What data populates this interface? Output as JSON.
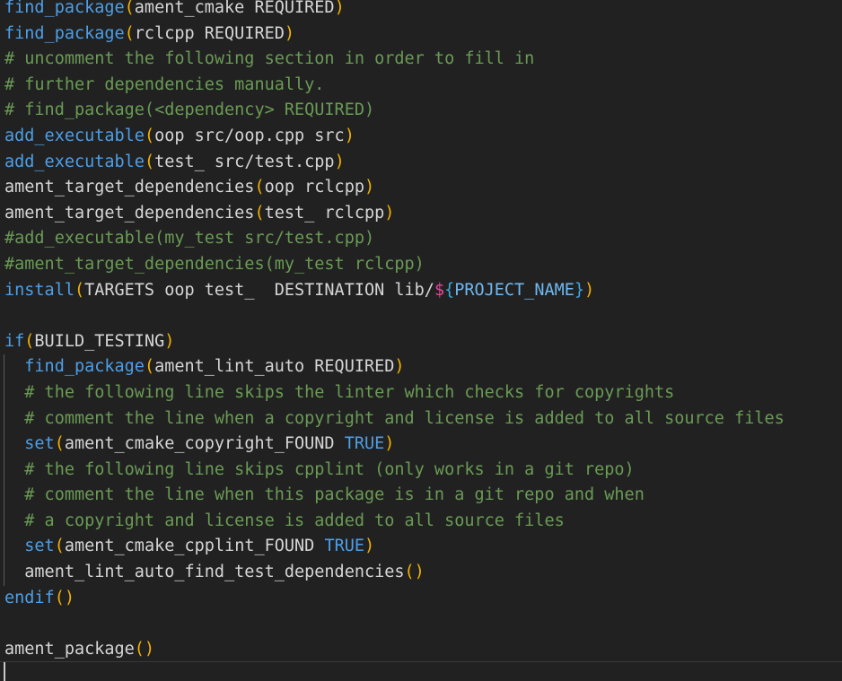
{
  "editor": {
    "language": "cmake",
    "background_color": "#212121",
    "colors": {
      "command": "#4d9fe8",
      "identifier": "#d6d6d6",
      "paren": "#f2b202",
      "comment": "#6a9b55",
      "keyword": "#4d9fe8",
      "variable_dollar": "#e8489b",
      "variable_brace": "#3aa9e0",
      "variable_name": "#6fb8f0",
      "indent_guide": "#5a5a5a",
      "caret": "#c8c8c8"
    },
    "caret_visible": true
  },
  "code": {
    "lines": [
      {
        "n": 1,
        "indent_guide": false,
        "tokens": [
          {
            "t": "find_package",
            "c": "cmd"
          },
          {
            "t": "(",
            "c": "paren"
          },
          {
            "t": "ament_cmake REQUIRED",
            "c": "id"
          },
          {
            "t": ")",
            "c": "paren"
          }
        ]
      },
      {
        "n": 2,
        "indent_guide": false,
        "tokens": [
          {
            "t": "find_package",
            "c": "cmd"
          },
          {
            "t": "(",
            "c": "paren"
          },
          {
            "t": "rclcpp REQUIRED",
            "c": "id"
          },
          {
            "t": ")",
            "c": "paren"
          }
        ]
      },
      {
        "n": 3,
        "indent_guide": false,
        "tokens": [
          {
            "t": "# uncomment the following section in order to fill in",
            "c": "comment"
          }
        ]
      },
      {
        "n": 4,
        "indent_guide": false,
        "tokens": [
          {
            "t": "# further dependencies manually.",
            "c": "comment"
          }
        ]
      },
      {
        "n": 5,
        "indent_guide": false,
        "tokens": [
          {
            "t": "# find_package(<dependency> REQUIRED)",
            "c": "comment"
          }
        ]
      },
      {
        "n": 6,
        "indent_guide": false,
        "tokens": [
          {
            "t": "add_executable",
            "c": "cmd"
          },
          {
            "t": "(",
            "c": "paren"
          },
          {
            "t": "oop src/oop.cpp src",
            "c": "id"
          },
          {
            "t": ")",
            "c": "paren"
          }
        ]
      },
      {
        "n": 7,
        "indent_guide": false,
        "tokens": [
          {
            "t": "add_executable",
            "c": "cmd"
          },
          {
            "t": "(",
            "c": "paren"
          },
          {
            "t": "test_ src/test.cpp",
            "c": "id"
          },
          {
            "t": ")",
            "c": "paren"
          }
        ]
      },
      {
        "n": 8,
        "indent_guide": false,
        "tokens": [
          {
            "t": "ament_target_dependencies",
            "c": "id"
          },
          {
            "t": "(",
            "c": "paren"
          },
          {
            "t": "oop rclcpp",
            "c": "id"
          },
          {
            "t": ")",
            "c": "paren"
          }
        ]
      },
      {
        "n": 9,
        "indent_guide": false,
        "tokens": [
          {
            "t": "ament_target_dependencies",
            "c": "id"
          },
          {
            "t": "(",
            "c": "paren"
          },
          {
            "t": "test_ rclcpp",
            "c": "id"
          },
          {
            "t": ")",
            "c": "paren"
          }
        ]
      },
      {
        "n": 10,
        "indent_guide": false,
        "tokens": [
          {
            "t": "#add_executable(my_test src/test.cpp)",
            "c": "comment"
          }
        ]
      },
      {
        "n": 11,
        "indent_guide": false,
        "tokens": [
          {
            "t": "#ament_target_dependencies(my_test rclcpp)",
            "c": "comment"
          }
        ]
      },
      {
        "n": 12,
        "indent_guide": false,
        "tokens": [
          {
            "t": "install",
            "c": "cmd"
          },
          {
            "t": "(",
            "c": "paren"
          },
          {
            "t": "TARGETS oop test_  DESTINATION lib/",
            "c": "id"
          },
          {
            "t": "$",
            "c": "dollar"
          },
          {
            "t": "{",
            "c": "brace"
          },
          {
            "t": "PROJECT_NAME",
            "c": "var"
          },
          {
            "t": "}",
            "c": "brace"
          },
          {
            "t": ")",
            "c": "paren"
          }
        ]
      },
      {
        "n": 13,
        "indent_guide": false,
        "tokens": [
          {
            "t": " ",
            "c": "id"
          }
        ]
      },
      {
        "n": 14,
        "indent_guide": false,
        "tokens": [
          {
            "t": "if",
            "c": "cmd"
          },
          {
            "t": "(",
            "c": "paren"
          },
          {
            "t": "BUILD_TESTING",
            "c": "id"
          },
          {
            "t": ")",
            "c": "paren"
          }
        ]
      },
      {
        "n": 15,
        "indent_guide": true,
        "tokens": [
          {
            "t": "  ",
            "c": "id"
          },
          {
            "t": "find_package",
            "c": "cmd"
          },
          {
            "t": "(",
            "c": "paren"
          },
          {
            "t": "ament_lint_auto REQUIRED",
            "c": "id"
          },
          {
            "t": ")",
            "c": "paren"
          }
        ]
      },
      {
        "n": 16,
        "indent_guide": true,
        "tokens": [
          {
            "t": "  # the following line skips the linter which checks for copyrights",
            "c": "comment"
          }
        ]
      },
      {
        "n": 17,
        "indent_guide": true,
        "tokens": [
          {
            "t": "  # comment the line when a copyright and license is added to all source files",
            "c": "comment"
          }
        ]
      },
      {
        "n": 18,
        "indent_guide": true,
        "tokens": [
          {
            "t": "  ",
            "c": "id"
          },
          {
            "t": "set",
            "c": "cmd"
          },
          {
            "t": "(",
            "c": "paren"
          },
          {
            "t": "ament_cmake_copyright_FOUND ",
            "c": "id"
          },
          {
            "t": "TRUE",
            "c": "kw"
          },
          {
            "t": ")",
            "c": "paren"
          }
        ]
      },
      {
        "n": 19,
        "indent_guide": true,
        "tokens": [
          {
            "t": "  # the following line skips cpplint (only works in a git repo)",
            "c": "comment"
          }
        ]
      },
      {
        "n": 20,
        "indent_guide": true,
        "tokens": [
          {
            "t": "  # comment the line when this package is in a git repo and when",
            "c": "comment"
          }
        ]
      },
      {
        "n": 21,
        "indent_guide": true,
        "tokens": [
          {
            "t": "  # a copyright and license is added to all source files",
            "c": "comment"
          }
        ]
      },
      {
        "n": 22,
        "indent_guide": true,
        "tokens": [
          {
            "t": "  ",
            "c": "id"
          },
          {
            "t": "set",
            "c": "cmd"
          },
          {
            "t": "(",
            "c": "paren"
          },
          {
            "t": "ament_cmake_cpplint_FOUND ",
            "c": "id"
          },
          {
            "t": "TRUE",
            "c": "kw"
          },
          {
            "t": ")",
            "c": "paren"
          }
        ]
      },
      {
        "n": 23,
        "indent_guide": true,
        "tokens": [
          {
            "t": "  ament_lint_auto_find_test_dependencies",
            "c": "id"
          },
          {
            "t": "()",
            "c": "paren"
          }
        ]
      },
      {
        "n": 24,
        "indent_guide": false,
        "tokens": [
          {
            "t": "endif",
            "c": "cmd"
          },
          {
            "t": "()",
            "c": "paren"
          }
        ]
      },
      {
        "n": 25,
        "indent_guide": false,
        "tokens": [
          {
            "t": " ",
            "c": "id"
          }
        ]
      },
      {
        "n": 26,
        "indent_guide": false,
        "tokens": [
          {
            "t": "ament_package",
            "c": "id"
          },
          {
            "t": "()",
            "c": "paren"
          }
        ]
      }
    ]
  }
}
